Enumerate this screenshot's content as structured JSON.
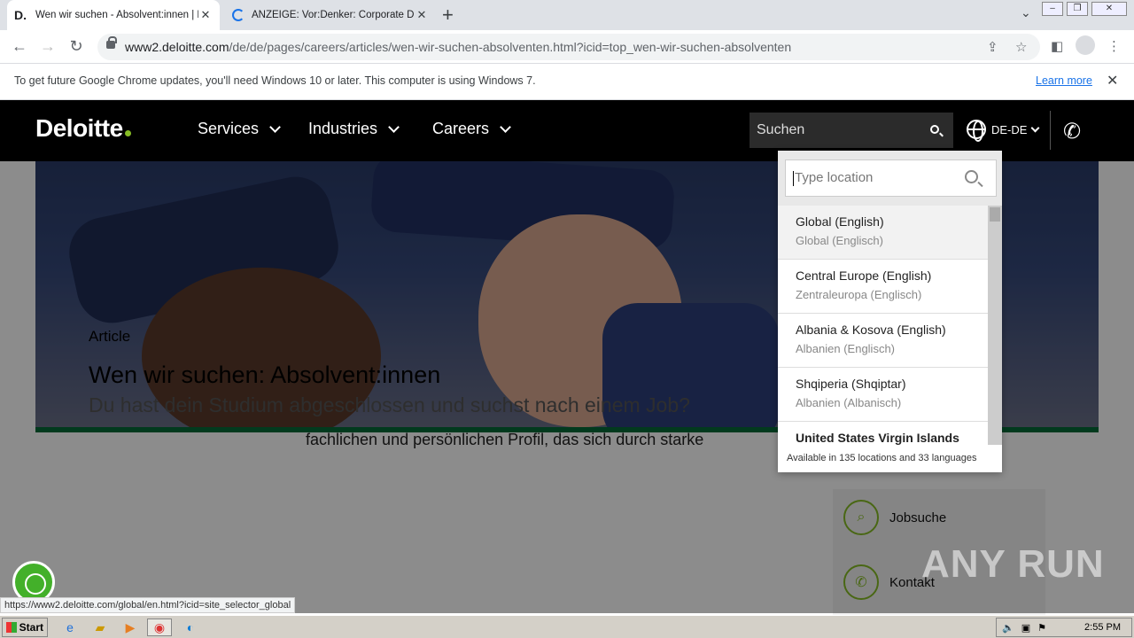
{
  "browser": {
    "tabs": [
      {
        "favicon": "D.",
        "title": "Wen wir suchen - Absolvent:innen | D"
      },
      {
        "favicon": "loading-spinner",
        "title": "ANZEIGE: Vor:Denker: Corporate Di"
      }
    ],
    "url_domain": "www2.deloitte.com",
    "url_path": "/de/de/pages/careers/articles/wen-wir-suchen-absolventen.html?icid=top_wen-wir-suchen-absolventen",
    "infobar": {
      "message": "To get future Google Chrome updates, you'll need Windows 10 or later. This computer is using Windows 7.",
      "learn_more": "Learn more"
    },
    "status_url": "https://www2.deloitte.com/global/en.html?icid=site_selector_global"
  },
  "header": {
    "logo": "Deloitte",
    "nav": [
      "Services",
      "Industries",
      "Careers"
    ],
    "search_placeholder": "Suchen",
    "locale": "DE-DE",
    "brand_green": "#86bc25"
  },
  "location_selector": {
    "placeholder": "Type location",
    "items": [
      {
        "primary": "Global (English)",
        "secondary": "Global (Englisch)"
      },
      {
        "primary": "Central Europe (English)",
        "secondary": "Zentraleuropa (Englisch)"
      },
      {
        "primary": "Albania & Kosova (English)",
        "secondary": "Albanien (Englisch)"
      },
      {
        "primary": "Shqiperia (Shqiptar)",
        "secondary": "Albanien (Albanisch)"
      },
      {
        "primary": "United States Virgin Islands",
        "secondary": ""
      }
    ],
    "footer": "Available in 135 locations and 33 languages"
  },
  "article": {
    "label": "Article",
    "title": "Wen wir suchen: Absolvent:innen",
    "subtitle": "Du hast dein Studium abgeschlossen und suchst nach einem Job?",
    "body_fragment": "fachlichen und persönlichen Profil, das sich durch starke"
  },
  "sidebar_links": [
    {
      "label": "Jobsuche",
      "icon": "job-search-icon"
    },
    {
      "label": "Kontakt",
      "icon": "phone-icon"
    }
  ],
  "watermark": "ANY RUN",
  "taskbar": {
    "start": "Start",
    "clock": "2:55 PM"
  }
}
